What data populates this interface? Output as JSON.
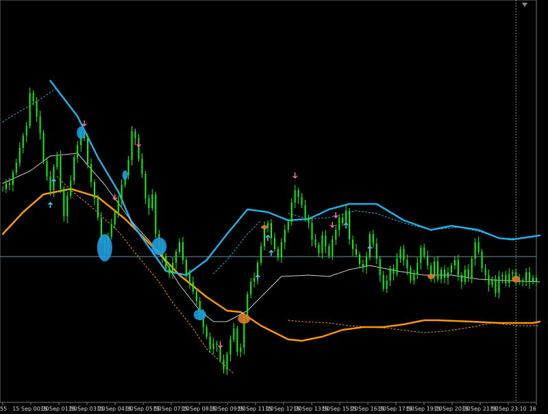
{
  "chart_data": {
    "type": "candlestick",
    "grid": false,
    "x_tick_labels": [
      "55",
      "15 Sep 00:30",
      "15 Sep 01:50",
      "15 Sep 03:10",
      "15 Sep 04:30",
      "15 Sep 05:50",
      "15 Sep 07:10",
      "15 Sep 08:30",
      "15 Sep 09:50",
      "15 Sep 11:10",
      "15 Sep 12:30",
      "15 Sep 13:50",
      "15 Sep 15:10",
      "15 Sep 16:30",
      "15 Sep 17:50",
      "15 Sep 19:10",
      "15 Sep 20:30",
      "15 Sep 21:50",
      "15 Sep 23:10",
      "16"
    ],
    "series": [
      {
        "type": "candlestick",
        "color": "#00ff00",
        "close": [
          312,
          320,
          318,
          336,
          350,
          372,
          390,
          404,
          452,
          440,
          418,
          394,
          352,
          330,
          310,
          344,
          360,
          312,
          272,
          302,
          324,
          358,
          376,
          394,
          386,
          348,
          322,
          298,
          270,
          238,
          226,
          242,
          260,
          278,
          296,
          318,
          332,
          354,
          396,
          386,
          356,
          334,
          298,
          284,
          304,
          246,
          228,
          214,
          196,
          188,
          204,
          220,
          234,
          208,
          188,
          176,
          162,
          148,
          128,
          110,
          96,
          78,
          86,
          84,
          62,
          48,
          70,
          92,
          108,
          74,
          80,
          122,
          158,
          176,
          182,
          204,
          228,
          256,
          262,
          240,
          224,
          212,
          234,
          252,
          264,
          292,
          310,
          300,
          288,
          270,
          262,
          238,
          230,
          218,
          244,
          228,
          214,
          238,
          252,
          270,
          262,
          280,
          238,
          224,
          216,
          202,
          198,
          212,
          246,
          232,
          210,
          186,
          166,
          178,
          196,
          188,
          210,
          224,
          208,
          196,
          178,
          188,
          204,
          226,
          214,
          200,
          184,
          206,
          180,
          194,
          182,
          190,
          200,
          208,
          186,
          176,
          194,
          182,
          210,
          234,
          220,
          196,
          186,
          172,
          180,
          160,
          184,
          186,
          174,
          188,
          190,
          180,
          176,
          178,
          190,
          176,
          182,
          176
        ]
      },
      {
        "name": "",
        "type": "line",
        "style": "solid",
        "color": "#ff9900",
        "y": [
          [
            0,
            246
          ],
          [
            6,
            278
          ],
          [
            12,
            304
          ],
          [
            20,
            312
          ],
          [
            28,
            300
          ],
          [
            36,
            268
          ],
          [
            44,
            228
          ],
          [
            52,
            186
          ],
          [
            60,
            154
          ],
          [
            66,
            134
          ],
          [
            70,
            132
          ],
          [
            76,
            112
          ],
          [
            84,
            92
          ],
          [
            88,
            90
          ],
          [
            94,
            96
          ],
          [
            100,
            106
          ],
          [
            106,
            110
          ],
          [
            112,
            110
          ],
          [
            118,
            114
          ],
          [
            124,
            120
          ],
          [
            128,
            120
          ],
          [
            138,
            118
          ],
          [
            146,
            116
          ],
          [
            156,
            116
          ],
          [
            158,
            118
          ]
        ]
      },
      {
        "name": "",
        "type": "line",
        "style": "solid",
        "color": "#1eb2e8",
        "y": [
          [
            14,
            470
          ],
          [
            22,
            418
          ],
          [
            28,
            358
          ],
          [
            34,
            308
          ],
          [
            38,
            262
          ],
          [
            44,
            220
          ],
          [
            48,
            192
          ],
          [
            54,
            186
          ],
          [
            60,
            208
          ],
          [
            66,
            246
          ],
          [
            70,
            270
          ],
          [
            72,
            282
          ],
          [
            78,
            278
          ],
          [
            84,
            266
          ],
          [
            90,
            268
          ],
          [
            96,
            282
          ],
          [
            102,
            290
          ],
          [
            110,
            290
          ],
          [
            118,
            266
          ],
          [
            126,
            252
          ],
          [
            132,
            258
          ],
          [
            140,
            252
          ],
          [
            146,
            240
          ],
          [
            150,
            238
          ],
          [
            158,
            244
          ]
        ]
      },
      {
        "name": "",
        "type": "line",
        "style": "solid",
        "color": "#d2d2d2",
        "y": [
          [
            0,
            320
          ],
          [
            8,
            338
          ],
          [
            14,
            360
          ],
          [
            22,
            364
          ],
          [
            30,
            318
          ],
          [
            38,
            264
          ],
          [
            46,
            220
          ],
          [
            52,
            172
          ],
          [
            58,
            134
          ],
          [
            62,
            118
          ],
          [
            66,
            118
          ],
          [
            72,
            134
          ],
          [
            78,
            164
          ],
          [
            82,
            184
          ],
          [
            90,
            186
          ],
          [
            96,
            184
          ],
          [
            102,
            194
          ],
          [
            108,
            200
          ],
          [
            116,
            192
          ],
          [
            124,
            186
          ],
          [
            132,
            186
          ],
          [
            140,
            180
          ],
          [
            148,
            178
          ],
          [
            158,
            176
          ]
        ]
      },
      {
        "name": "",
        "type": "line",
        "style": "dotted",
        "color": "#ff9900",
        "y": [
          [
            16,
            330
          ],
          [
            20,
            310
          ],
          [
            26,
            286
          ],
          [
            34,
            250
          ],
          [
            40,
            212
          ],
          [
            46,
            176
          ],
          [
            50,
            146
          ],
          [
            56,
            108
          ],
          [
            60,
            78
          ],
          [
            64,
            60
          ],
          [
            68,
            42
          ]
        ]
      },
      {
        "name": "",
        "type": "line",
        "style": "dotted",
        "color": "#ff9900",
        "y": [
          [
            84,
            120
          ],
          [
            88,
            118
          ],
          [
            96,
            116
          ],
          [
            102,
            112
          ],
          [
            108,
            110
          ],
          [
            114,
            108
          ],
          [
            120,
            104
          ],
          [
            124,
            102
          ],
          [
            130,
            104
          ],
          [
            138,
            110
          ],
          [
            144,
            116
          ],
          [
            152,
            112
          ],
          [
            158,
            112
          ]
        ]
      },
      {
        "name": "",
        "type": "line",
        "style": "dotted",
        "color": "#1eb2e8",
        "y": [
          [
            0,
            410
          ],
          [
            6,
            428
          ],
          [
            12,
            446
          ],
          [
            16,
            460
          ]
        ]
      },
      {
        "name": "",
        "type": "line",
        "style": "dotted",
        "color": "#1eb2e8",
        "y": [
          [
            62,
            188
          ],
          [
            66,
            208
          ],
          [
            72,
            246
          ],
          [
            76,
            266
          ]
        ]
      },
      {
        "name": "",
        "type": "line",
        "style": "dotted",
        "color": "#1eb2e8",
        "y": [
          [
            84,
            276
          ],
          [
            90,
            268
          ],
          [
            96,
            270
          ],
          [
            104,
            280
          ],
          [
            110,
            276
          ],
          [
            118,
            262
          ],
          [
            126,
            252
          ],
          [
            134,
            256
          ],
          [
            140,
            250
          ],
          [
            146,
            240
          ],
          [
            152,
            240
          ],
          [
            158,
            244
          ]
        ]
      }
    ],
    "arrows": [
      {
        "i": 14,
        "dir": "up",
        "color": "#39d6ff"
      },
      {
        "i": 15,
        "dir": "up",
        "color": "#39d6ff"
      },
      {
        "i": 24,
        "dir": "down",
        "color": "#ff6ea8"
      },
      {
        "i": 33,
        "dir": "down",
        "color": "#ff6ea8"
      },
      {
        "i": 40,
        "dir": "down",
        "color": "#ff6ea8"
      },
      {
        "i": 64,
        "dir": "down",
        "color": "#ff6ea8"
      },
      {
        "i": 75,
        "dir": "up",
        "color": "#39d6ff"
      },
      {
        "i": 78,
        "dir": "up",
        "color": "#39d6ff"
      },
      {
        "i": 79,
        "dir": "up",
        "color": "#39d6ff"
      },
      {
        "i": 86,
        "dir": "down",
        "color": "#ff6ea8"
      },
      {
        "i": 97,
        "dir": "down",
        "color": "#ff6ea8"
      },
      {
        "i": 98,
        "dir": "down",
        "color": "#ff6ea8"
      },
      {
        "i": 101,
        "dir": "up",
        "color": "#39d6ff"
      },
      {
        "i": 108,
        "dir": "up",
        "color": "#39d6ff"
      }
    ],
    "ellipses": [
      {
        "i": 23,
        "rx": 6,
        "ry": 9,
        "color": "#1f9dde"
      },
      {
        "i": 30,
        "rx": 11,
        "ry": 20,
        "color": "#1f9dde"
      },
      {
        "i": 36,
        "rx": 4,
        "ry": 7,
        "color": "#1f9dde"
      },
      {
        "i": 46,
        "rx": 11,
        "ry": 13,
        "color": "#1f9dde"
      },
      {
        "i": 58,
        "rx": 9,
        "ry": 8,
        "color": "#1f9dde"
      },
      {
        "i": 71,
        "rx": 9,
        "ry": 7,
        "color": "#e07a2a"
      },
      {
        "i": 77,
        "rx": 5,
        "ry": 3,
        "color": "#e07a2a"
      },
      {
        "i": 126,
        "rx": 5,
        "ry": 4,
        "color": "#e07a2a"
      },
      {
        "i": 151,
        "rx": 6,
        "ry": 5,
        "color": "#e07a2a"
      }
    ],
    "horizontal_line": {
      "y": 213,
      "color": "#6f8fa8"
    },
    "vertical_line": {
      "i": 151,
      "color": "#999999",
      "style": "dashed"
    },
    "cursor": {
      "i": 151
    }
  }
}
